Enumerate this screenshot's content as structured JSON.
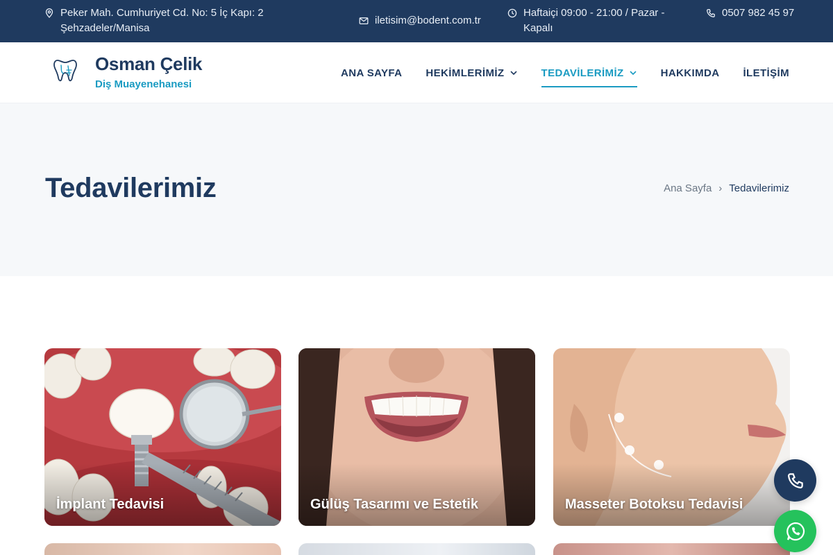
{
  "topbar": {
    "address": "Peker Mah. Cumhuriyet Cd. No: 5 İç Kapı: 2 Şehzadeler/Manisa",
    "email": "iletisim@bodent.com.tr",
    "hours": "Haftaiçi 09:00 - 21:00 / Pazar - Kapalı",
    "phone": "0507 982 45 97"
  },
  "brand": {
    "name": "Osman Çelik",
    "subtitle": "Diş Muayenehanesi"
  },
  "nav": {
    "items": [
      {
        "label": "ANA SAYFA"
      },
      {
        "label": "HEKİMLERİMİZ"
      },
      {
        "label": "TEDAVİLERİMİZ"
      },
      {
        "label": "HAKKIMDA"
      },
      {
        "label": "İLETİŞİM"
      }
    ]
  },
  "page": {
    "title": "Tedavilerimiz",
    "breadcrumb": {
      "home": "Ana Sayfa",
      "separator": "›",
      "current": "Tedavilerimiz"
    }
  },
  "treatments": [
    {
      "title": "İmplant Tedavisi"
    },
    {
      "title": "Gülüş Tasarımı ve Estetik"
    },
    {
      "title": "Masseter Botoksu Tedavisi"
    }
  ],
  "colors": {
    "navy": "#1f3a5f",
    "accent": "#1a9bc2",
    "whatsapp": "#25c25c"
  },
  "icons": {
    "address": "map-pin-icon",
    "email": "mail-icon",
    "hours": "clock-icon",
    "phone": "phone-icon",
    "whatsapp": "whatsapp-icon"
  }
}
